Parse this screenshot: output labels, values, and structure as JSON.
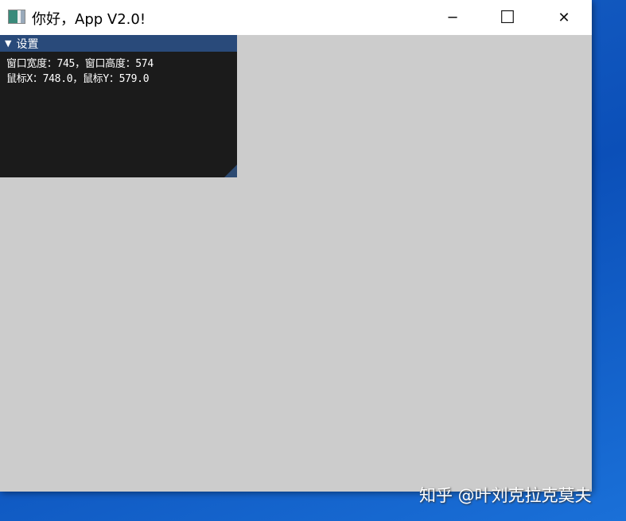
{
  "window": {
    "title": "你好，App V2.0!",
    "minimize": "─",
    "maximize": "☐",
    "close": "✕"
  },
  "panel": {
    "title": "设置",
    "lines": [
      "窗口宽度：745，窗口高度：574",
      "鼠标X：748.0，鼠标Y：579.0"
    ]
  },
  "watermark": "知乎 @叶刘克拉克莫夫"
}
